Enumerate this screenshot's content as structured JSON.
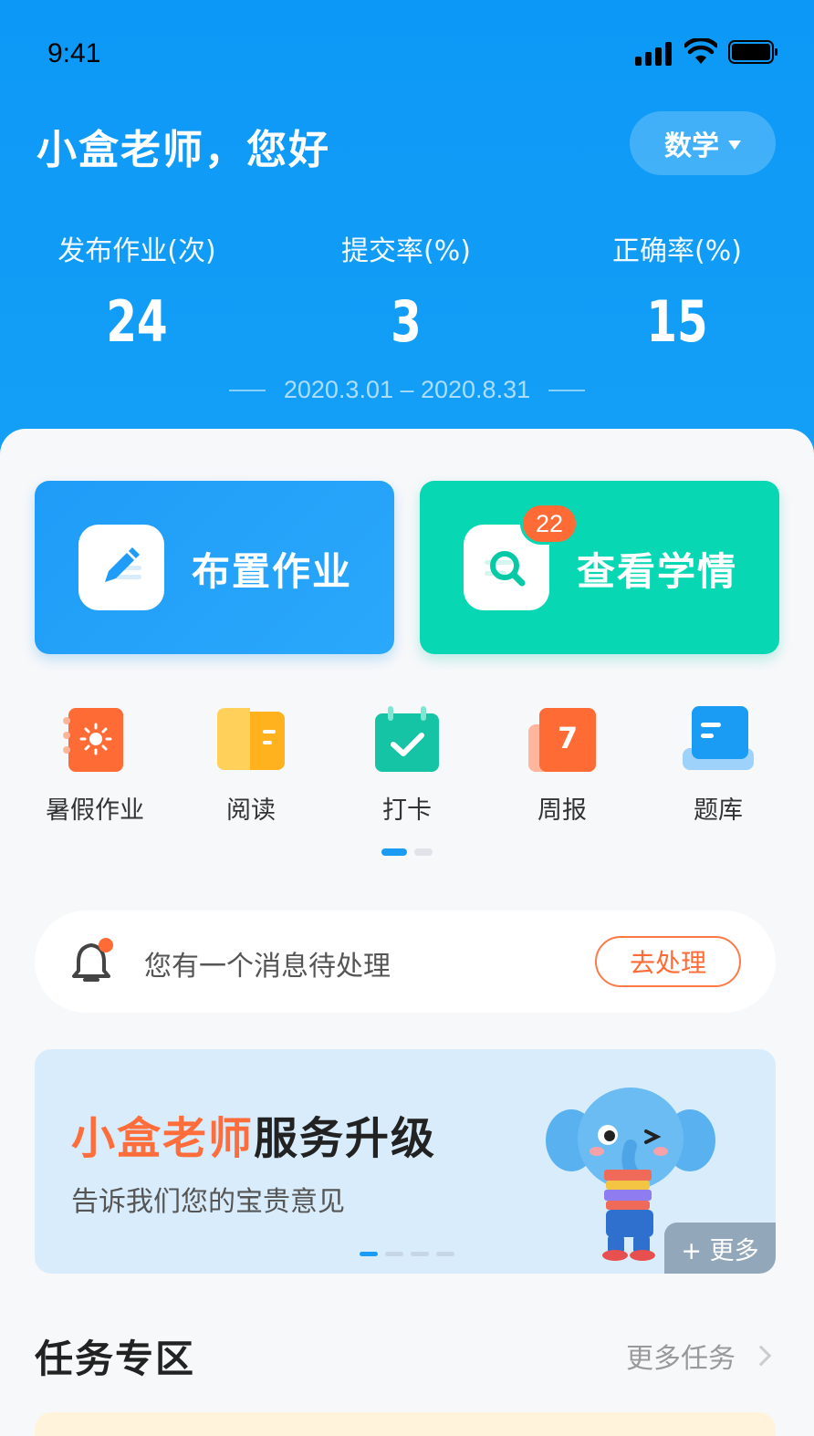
{
  "status_bar": {
    "time": "9:41"
  },
  "header": {
    "greeting": "小盒老师，您好",
    "subject": "数学",
    "stats": [
      {
        "label": "发布作业(次)",
        "value": "24"
      },
      {
        "label": "提交率(%)",
        "value": "3"
      },
      {
        "label": "正确率(%)",
        "value": "15"
      }
    ],
    "date_range": "2020.3.01 – 2020.8.31"
  },
  "actions": {
    "assign": {
      "label": "布置作业"
    },
    "check": {
      "label": "查看学情",
      "badge": "22"
    }
  },
  "shortcuts": [
    {
      "label": "暑假作业",
      "icon": "summer-homework-icon"
    },
    {
      "label": "阅读",
      "icon": "reading-book-icon"
    },
    {
      "label": "打卡",
      "icon": "checkin-calendar-icon"
    },
    {
      "label": "周报",
      "icon": "weekly-report-icon",
      "number": "7"
    },
    {
      "label": "题库",
      "icon": "question-bank-icon"
    }
  ],
  "shortcut_pager": {
    "pages": 2,
    "active": 0
  },
  "notice": {
    "text": "您有一个消息待处理",
    "button": "去处理"
  },
  "banner": {
    "title_highlight": "小盒老师",
    "title_rest": "服务升级",
    "subtitle": "告诉我们您的宝贵意见",
    "more": "+ 更多",
    "pages": 4,
    "active": 0
  },
  "tasks": {
    "title": "任务专区",
    "more": "更多任务"
  },
  "colors": {
    "primary": "#0f9bf5",
    "teal": "#08d7b3",
    "orange": "#ff6b35",
    "banner_bg": "#d8ecfc"
  }
}
